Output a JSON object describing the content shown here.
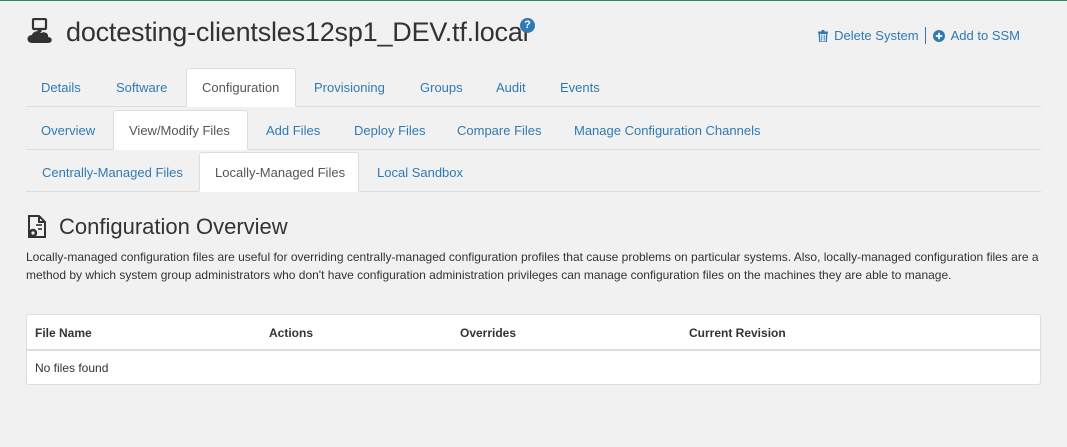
{
  "header": {
    "system_name": "doctesting-clientsles12sp1_DEV.tf.local",
    "help_icon": "question-circle-icon",
    "help_glyph": "?",
    "delete_label": "Delete System",
    "add_ssm_label": "Add to SSM"
  },
  "tabs_main": [
    "Details",
    "Software",
    "Configuration",
    "Provisioning",
    "Groups",
    "Audit",
    "Events"
  ],
  "tabs_config": [
    "Overview",
    "View/Modify Files",
    "Add Files",
    "Deploy Files",
    "Compare Files",
    "Manage Configuration Channels"
  ],
  "tabs_files": [
    "Centrally-Managed Files",
    "Locally-Managed Files",
    "Local Sandbox"
  ],
  "active_tabs": {
    "main": "Configuration",
    "config": "View/Modify Files",
    "files": "Locally-Managed Files"
  },
  "section": {
    "title": "Configuration Overview",
    "icon": "file-gear-icon",
    "description": "Locally-managed configuration files are useful for overriding centrally-managed configuration profiles that cause problems on particular systems. Also, locally-managed configuration files are a method by which system group administrators who don't have configuration administration privileges can manage configuration files on the machines they are able to manage."
  },
  "table": {
    "columns": [
      "File Name",
      "Actions",
      "Overrides",
      "Current Revision"
    ],
    "empty_message": "No files found"
  },
  "colors": {
    "link": "#2f7ab5",
    "background": "#f1f1f1",
    "accent_top": "#2e8b57"
  }
}
